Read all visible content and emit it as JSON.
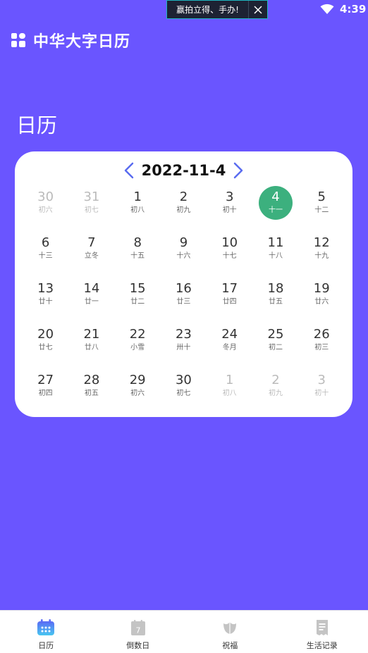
{
  "status_bar": {
    "ad_text": "赢拍立得、手办!",
    "time": "4:39"
  },
  "header": {
    "title": "中华大字日历"
  },
  "section": {
    "title": "日历"
  },
  "calendar": {
    "current_date": "2022-11-4",
    "selected_color": "#3cb07e",
    "weeks": [
      [
        {
          "day": "30",
          "lunar": "初六",
          "muted": true
        },
        {
          "day": "31",
          "lunar": "初七",
          "muted": true
        },
        {
          "day": "1",
          "lunar": "初八"
        },
        {
          "day": "2",
          "lunar": "初九"
        },
        {
          "day": "3",
          "lunar": "初十"
        },
        {
          "day": "4",
          "lunar": "十一",
          "selected": true
        },
        {
          "day": "5",
          "lunar": "十二"
        }
      ],
      [
        {
          "day": "6",
          "lunar": "十三"
        },
        {
          "day": "7",
          "lunar": "立冬"
        },
        {
          "day": "8",
          "lunar": "十五"
        },
        {
          "day": "9",
          "lunar": "十六"
        },
        {
          "day": "10",
          "lunar": "十七"
        },
        {
          "day": "11",
          "lunar": "十八"
        },
        {
          "day": "12",
          "lunar": "十九"
        }
      ],
      [
        {
          "day": "13",
          "lunar": "廿十"
        },
        {
          "day": "14",
          "lunar": "廿一"
        },
        {
          "day": "15",
          "lunar": "廿二"
        },
        {
          "day": "16",
          "lunar": "廿三"
        },
        {
          "day": "17",
          "lunar": "廿四"
        },
        {
          "day": "18",
          "lunar": "廿五"
        },
        {
          "day": "19",
          "lunar": "廿六"
        }
      ],
      [
        {
          "day": "20",
          "lunar": "廿七"
        },
        {
          "day": "21",
          "lunar": "廿八"
        },
        {
          "day": "22",
          "lunar": "小雪"
        },
        {
          "day": "23",
          "lunar": "卅十"
        },
        {
          "day": "24",
          "lunar": "冬月"
        },
        {
          "day": "25",
          "lunar": "初二"
        },
        {
          "day": "26",
          "lunar": "初三"
        }
      ],
      [
        {
          "day": "27",
          "lunar": "初四"
        },
        {
          "day": "28",
          "lunar": "初五"
        },
        {
          "day": "29",
          "lunar": "初六"
        },
        {
          "day": "30",
          "lunar": "初七"
        },
        {
          "day": "1",
          "lunar": "初八",
          "muted": true
        },
        {
          "day": "2",
          "lunar": "初九",
          "muted": true
        },
        {
          "day": "3",
          "lunar": "初十",
          "muted": true
        }
      ]
    ]
  },
  "bottom_nav": {
    "tabs": [
      {
        "label": "日历",
        "icon": "calendar-icon",
        "active": true
      },
      {
        "label": "倒数日",
        "icon": "countdown-icon"
      },
      {
        "label": "祝福",
        "icon": "flower-icon"
      },
      {
        "label": "生活记录",
        "icon": "notes-icon"
      }
    ],
    "countdown_icon_text": "7"
  },
  "colors": {
    "background": "#6a55ff",
    "accent": "#5a6cf0",
    "muted_icon": "#c4c4c4"
  }
}
